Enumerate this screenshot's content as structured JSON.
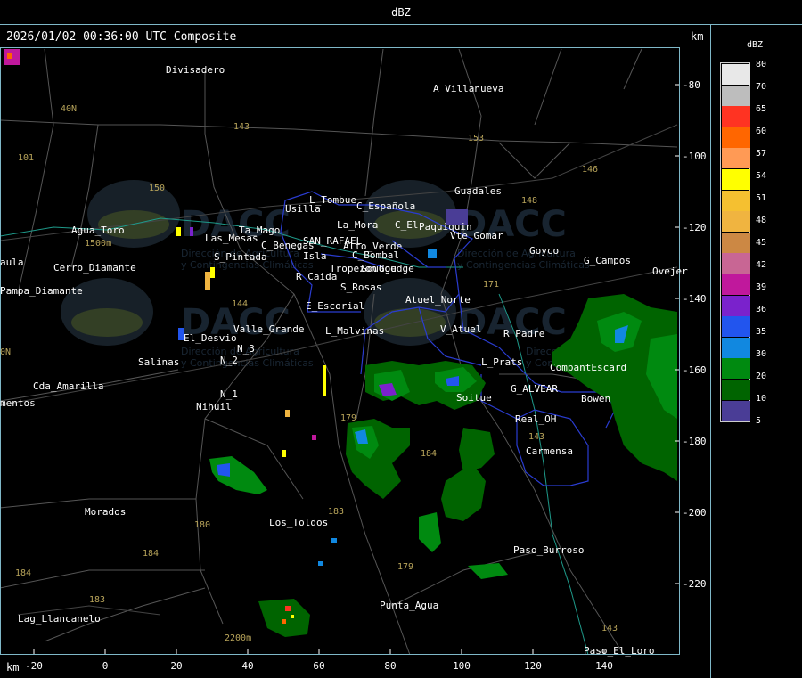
{
  "header": {
    "title": "dBZ"
  },
  "timestamp": "2026/01/02 00:36:00 UTC Composite",
  "units": {
    "top_right": "km",
    "bottom_left": "km"
  },
  "axes": {
    "x_ticks": [
      "-20",
      "0",
      "20",
      "40",
      "60",
      "80",
      "100",
      "120",
      "140"
    ],
    "y_ticks": [
      "-80",
      "-100",
      "-120",
      "-140",
      "-160",
      "-180",
      "-200",
      "-220"
    ]
  },
  "legend": {
    "title": "dBZ",
    "items": [
      {
        "label": "80",
        "color": "#e8e8e8"
      },
      {
        "label": "70",
        "color": "#bdbdbd"
      },
      {
        "label": "65",
        "color": "#ff3322"
      },
      {
        "label": "60",
        "color": "#ff6600"
      },
      {
        "label": "57",
        "color": "#ff9a55"
      },
      {
        "label": "54",
        "color": "#ffff00"
      },
      {
        "label": "51",
        "color": "#f5c030"
      },
      {
        "label": "48",
        "color": "#f0b440"
      },
      {
        "label": "45",
        "color": "#cc8844"
      },
      {
        "label": "42",
        "color": "#c86694"
      },
      {
        "label": "39",
        "color": "#c0189c"
      },
      {
        "label": "36",
        "color": "#7a22cc"
      },
      {
        "label": "35",
        "color": "#2255ee"
      },
      {
        "label": "30",
        "color": "#1188e0"
      },
      {
        "label": "20",
        "color": "#008a10"
      },
      {
        "label": "10",
        "color": "#006400"
      },
      {
        "label": "5",
        "color": "#4a3d96"
      }
    ]
  },
  "watermark": {
    "brand": "DACC",
    "line1": "Dirección de Agricultura",
    "line2": "y Contingencias Climáticas"
  },
  "places": [
    {
      "name": "Divisadero"
    },
    {
      "name": "A_Villanueva"
    },
    {
      "name": "40N"
    },
    {
      "name": "101"
    },
    {
      "name": "143"
    },
    {
      "name": "153"
    },
    {
      "name": "146"
    },
    {
      "name": "150"
    },
    {
      "name": "Guadales"
    },
    {
      "name": "148"
    },
    {
      "name": "L_Tombue"
    },
    {
      "name": "Usilla"
    },
    {
      "name": "C_Española"
    },
    {
      "name": "La_Mora"
    },
    {
      "name": "C_El"
    },
    {
      "name": "Paquiquin"
    },
    {
      "name": "Vte_Gomar"
    },
    {
      "name": "Agua_Toro"
    },
    {
      "name": "1500m"
    },
    {
      "name": "Las_Mesas"
    },
    {
      "name": "Ta_Mago"
    },
    {
      "name": "C_Benegas"
    },
    {
      "name": "SAN_RAFAEL"
    },
    {
      "name": "Alto_Verde"
    },
    {
      "name": "Goudge"
    },
    {
      "name": "C_Bombal"
    },
    {
      "name": "Goyco"
    },
    {
      "name": "G_Campos"
    },
    {
      "name": "Ovejer"
    },
    {
      "name": "S_Pintada"
    },
    {
      "name": "Isla"
    },
    {
      "name": "Tropezon"
    },
    {
      "name": "Goudge"
    },
    {
      "name": "Pampa_Diamante"
    },
    {
      "name": "Cerro_Diamante"
    },
    {
      "name": "R_Caida"
    },
    {
      "name": "S_Rosas"
    },
    {
      "name": "171"
    },
    {
      "name": "144"
    },
    {
      "name": "E_Escorial"
    },
    {
      "name": "Atuel_Norte"
    },
    {
      "name": "El_Desvio"
    },
    {
      "name": "Valle_Grande"
    },
    {
      "name": "L_Malvinas"
    },
    {
      "name": "V_Atuel"
    },
    {
      "name": "R_Padre"
    },
    {
      "name": "Salinas"
    },
    {
      "name": "N_2"
    },
    {
      "name": "N_3"
    },
    {
      "name": "L_Prats"
    },
    {
      "name": "CompantEscard"
    },
    {
      "name": "Cda_Amarilla"
    },
    {
      "name": "N_1"
    },
    {
      "name": "G_ALVEAR"
    },
    {
      "name": "Bowen"
    },
    {
      "name": "Soitue"
    },
    {
      "name": "Nihuil"
    },
    {
      "name": "mentos"
    },
    {
      "name": "Real_OH"
    },
    {
      "name": "179"
    },
    {
      "name": "143"
    },
    {
      "name": "184"
    },
    {
      "name": "Carmensa"
    },
    {
      "name": "Morados"
    },
    {
      "name": "180"
    },
    {
      "name": "183"
    },
    {
      "name": "Los_Toldos"
    },
    {
      "name": "184"
    },
    {
      "name": "Paso_Burroso"
    },
    {
      "name": "179"
    },
    {
      "name": "184"
    },
    {
      "name": "183"
    },
    {
      "name": "Punta_Agua"
    },
    {
      "name": "Lag_Llancanelo"
    },
    {
      "name": "2200m"
    },
    {
      "name": "143"
    },
    {
      "name": "Paso_El_Loro"
    },
    {
      "name": "aula"
    },
    {
      "name": "0N"
    }
  ]
}
